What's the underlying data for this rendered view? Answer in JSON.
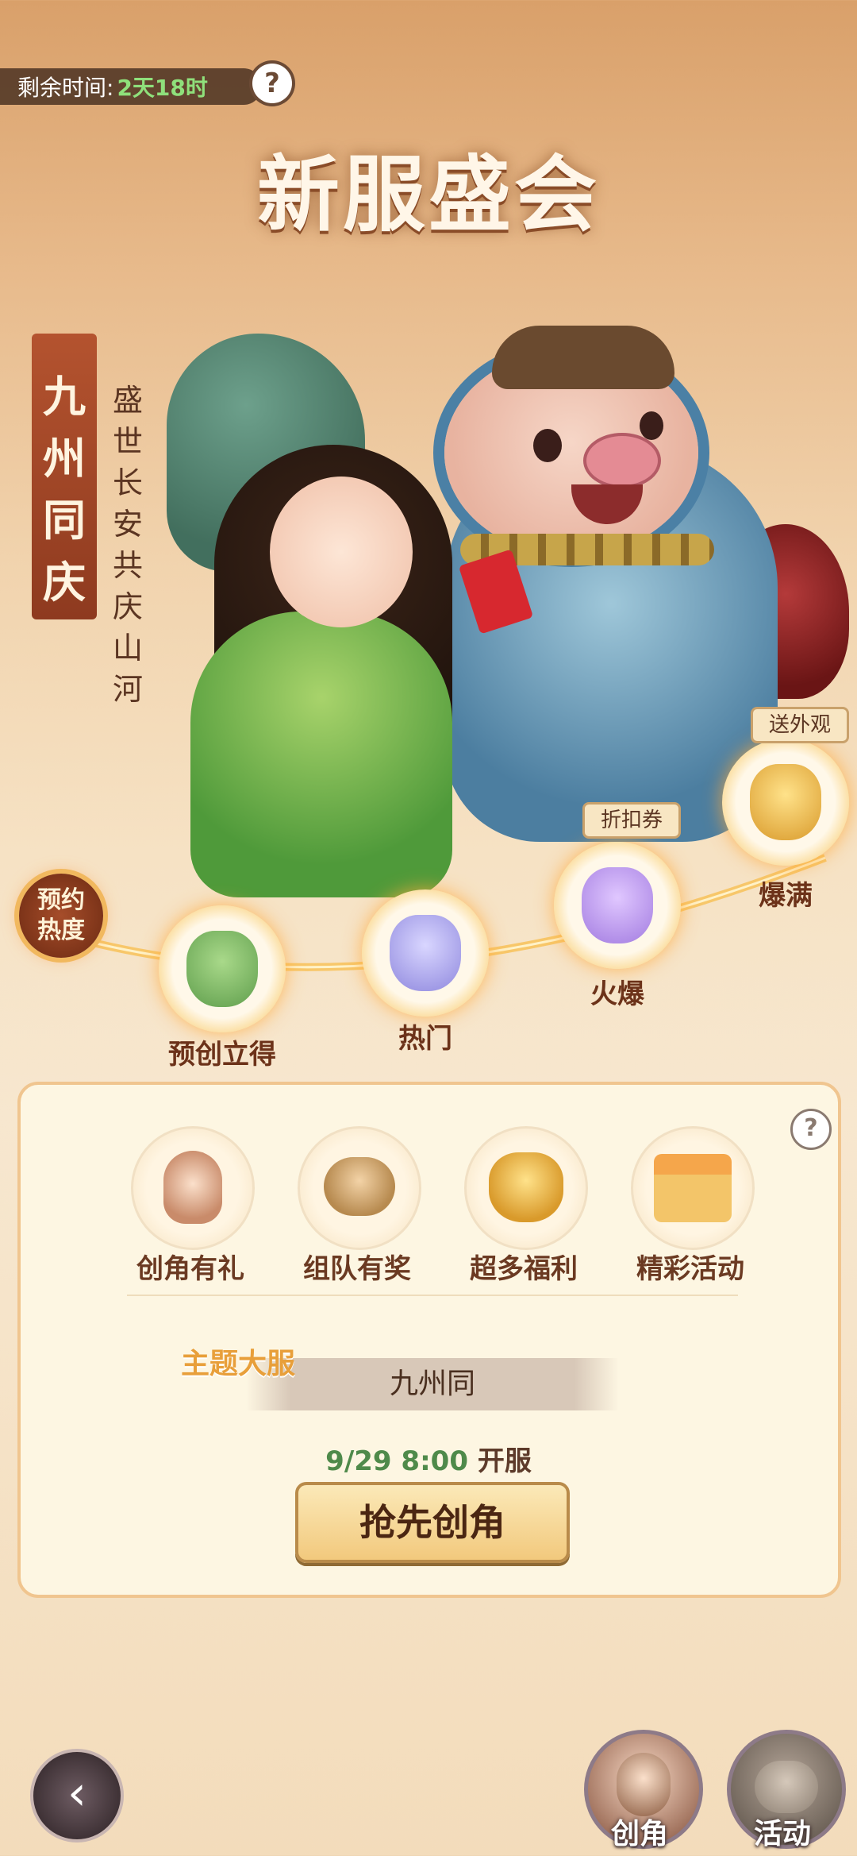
{
  "header": {
    "timer_label": "剩余时间:",
    "timer_value": "2天18时",
    "help": "?",
    "title": "新服盛会"
  },
  "banner": {
    "main": "九州同庆",
    "sub": "盛世长安共庆山河"
  },
  "progress": {
    "heat_label": "预约热度",
    "nodes": [
      {
        "label": "预创立得",
        "tag": ""
      },
      {
        "label": "热门",
        "tag": ""
      },
      {
        "label": "火爆",
        "tag": "折扣券"
      },
      {
        "label": "爆满",
        "tag": "送外观"
      }
    ]
  },
  "card": {
    "help": "?",
    "features": [
      {
        "label": "创角有礼",
        "icon": "character-avatar-icon"
      },
      {
        "label": "组队有奖",
        "icon": "handshake-icon"
      },
      {
        "label": "超多福利",
        "icon": "gold-bag-icon"
      },
      {
        "label": "精彩活动",
        "icon": "gift-box-icon"
      }
    ],
    "theme_label": "主题大服",
    "theme_value": "九州同",
    "open_date": "9/29",
    "open_time": "8:00",
    "open_suffix": "开服",
    "cta": "抢先创角"
  },
  "bottom": {
    "tabs": [
      {
        "label": "创角"
      },
      {
        "label": "活动"
      }
    ]
  },
  "colors": {
    "accent_green": "#4f8a4a",
    "timer_green": "#8fe07b",
    "card_bg": "#fdf6e2",
    "brown_text": "#6b3a22"
  }
}
